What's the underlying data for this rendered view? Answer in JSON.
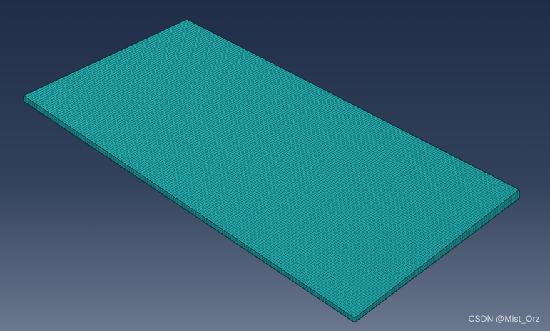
{
  "viewport": {
    "background_top": "#1f2d48",
    "background_bottom": "#6b778f"
  },
  "mesh_plate": {
    "face_color": "#1fa0a2",
    "face_highlight": "#27b3b3",
    "side_color": "#167f82",
    "edge_color": "#0b2f33",
    "mesh_line_color": "#0d3a3d"
  },
  "watermark": {
    "text": "CSDN @Mist_Orz"
  }
}
